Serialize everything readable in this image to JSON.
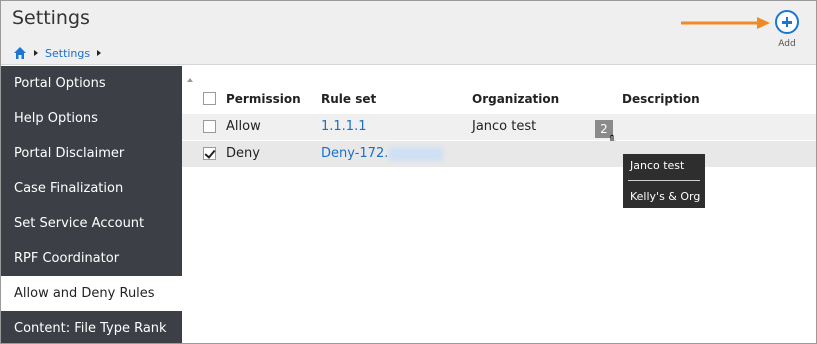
{
  "header": {
    "title": "Settings",
    "breadcrumb": {
      "home_icon": "home-icon",
      "item": "Settings"
    },
    "add_label": "Add"
  },
  "sidebar": {
    "items": [
      {
        "label": "Portal Options",
        "active": false
      },
      {
        "label": "Help Options",
        "active": false
      },
      {
        "label": "Portal Disclaimer",
        "active": false
      },
      {
        "label": "Case Finalization",
        "active": false
      },
      {
        "label": "Set Service Account",
        "active": false
      },
      {
        "label": "RPF Coordinator",
        "active": false
      },
      {
        "label": "Allow and Deny Rules",
        "active": true
      },
      {
        "label": "Content: File Type Rank",
        "active": false
      }
    ]
  },
  "table": {
    "columns": [
      "Permission",
      "Rule set",
      "Organization",
      "Description"
    ],
    "rows": [
      {
        "checked": false,
        "permission": "Allow",
        "rule_set": "1.1.1.1",
        "organization": "Janco test",
        "org_count": "2",
        "description": ""
      },
      {
        "checked": true,
        "permission": "Deny",
        "rule_set": "Deny-172.",
        "organization": "",
        "description": ""
      }
    ]
  },
  "tooltip": {
    "lines": [
      "Janco test",
      "Kelly's & Org"
    ]
  },
  "colors": {
    "sidebar_bg": "#3c4046",
    "accent_blue": "#1976d2",
    "link_blue": "#1a6fc9",
    "annotation_arrow": "#f08a24"
  }
}
